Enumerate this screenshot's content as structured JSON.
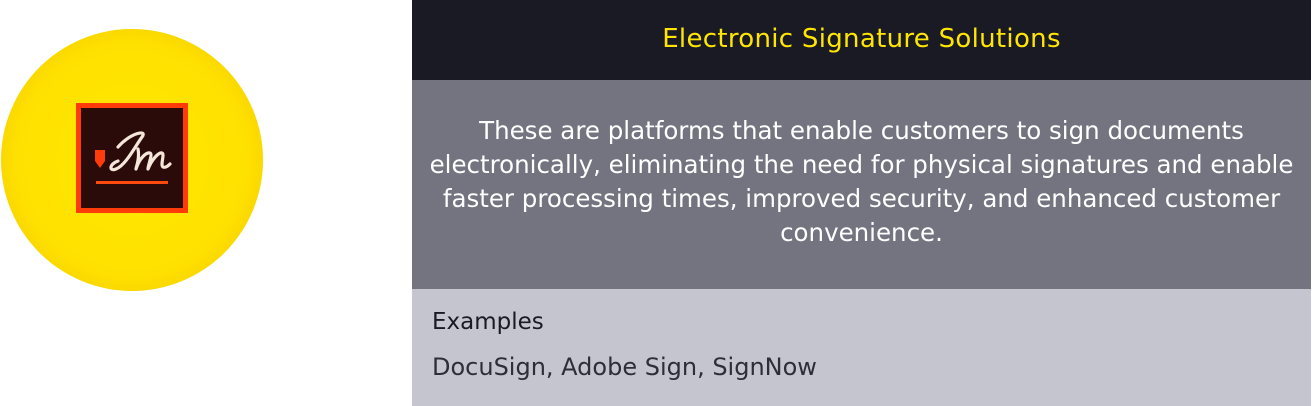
{
  "card": {
    "title": "Electronic Signature Solutions",
    "description": "These are platforms that enable customers to sign documents electronically, eliminating the need for physical signatures and enable faster processing times, improved security, and enhanced customer convenience.",
    "examples_heading": "Examples",
    "examples_list": "DocuSign, Adobe Sign, SignNow"
  },
  "icon": {
    "name": "e-signature-icon",
    "circle_color": "#ffe100",
    "tile_color": "#2b0a0a",
    "tile_border_color": "#ff3b0a",
    "glyph_color": "#f4e6d8",
    "underline_color": "#ff4a10"
  },
  "colors": {
    "header_bg": "#1a1a24",
    "title_color": "#ffe600",
    "description_bg": "#747480",
    "examples_bg": "#c4c5ce"
  }
}
